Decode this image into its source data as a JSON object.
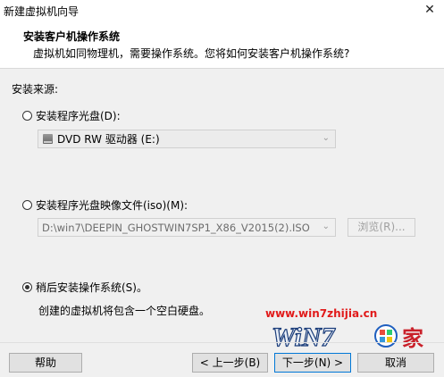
{
  "window": {
    "title": "新建虚拟机向导",
    "close_glyph": "✕"
  },
  "header": {
    "title": "安装客户机操作系统",
    "subtitle": "虚拟机如同物理机，需要操作系统。您将如何安装客户机操作系统?"
  },
  "install_source": {
    "label": "安装来源:",
    "options": [
      {
        "label": "安装程序光盘(D):",
        "selected": false
      },
      {
        "label": "安装程序光盘映像文件(iso)(M):",
        "selected": false
      },
      {
        "label": "稍后安装操作系统(S)。",
        "selected": true
      }
    ],
    "disc_combo": {
      "value": "DVD RW 驱动器 (E:)",
      "icon": "optical-drive-icon"
    },
    "iso_combo": {
      "value": "D:\\win7\\DEEPIN_GHOSTWIN7SP1_X86_V2015(2).ISO"
    },
    "browse_label": "浏览(R)...",
    "later_note": "创建的虚拟机将包含一个空白硬盘。"
  },
  "footer": {
    "help": "帮助",
    "back": "< 上一步(B)",
    "next": "下一步(N) >",
    "cancel": "取消"
  },
  "watermark": {
    "url": "www.win7zhijia.cn",
    "brand": "WiN7",
    "suffix": "家"
  }
}
